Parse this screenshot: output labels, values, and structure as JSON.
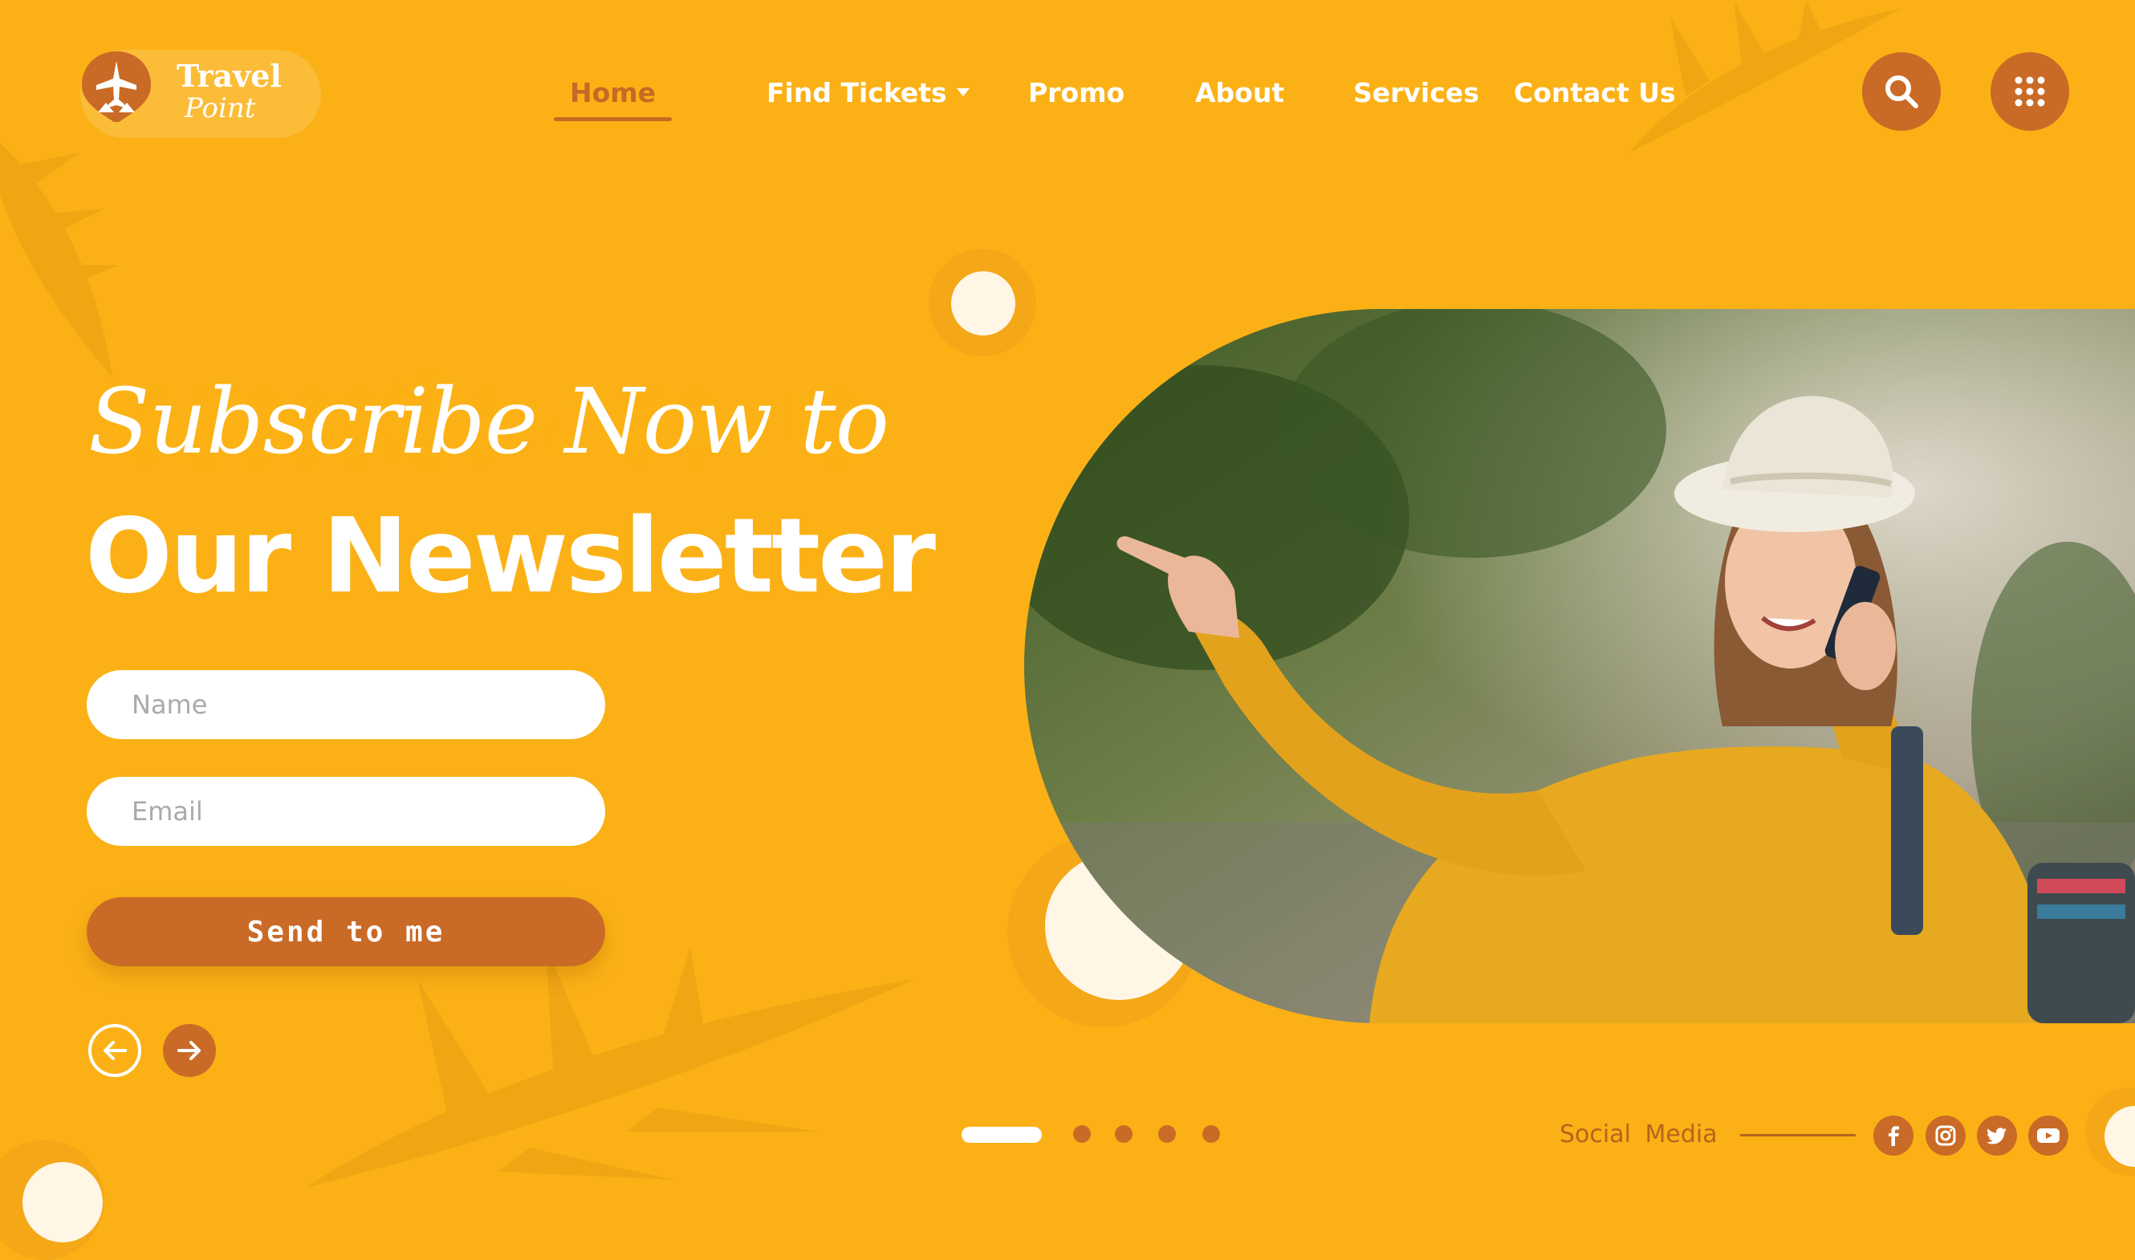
{
  "theme": {
    "background": "#fbb116",
    "accent": "#c96a26",
    "text": "#ffffff"
  },
  "logo": {
    "title": "Travel",
    "subtitle": "Point",
    "icon": "airplane-pin-icon"
  },
  "nav": {
    "items": [
      {
        "label": "Home",
        "active": true
      },
      {
        "label": "Find Tickets",
        "has_dropdown": true
      },
      {
        "label": "Promo"
      },
      {
        "label": "About"
      },
      {
        "label": "Services"
      },
      {
        "label": "Contact Us"
      }
    ],
    "search_icon": "search-icon",
    "menu_icon": "grid-menu-icon"
  },
  "hero": {
    "script_title": "Subscribe Now to",
    "title": "Our Newsletter"
  },
  "form": {
    "name_placeholder": "Name",
    "email_placeholder": "Email",
    "submit_label": "Send to me"
  },
  "carousel": {
    "prev_icon": "arrow-left-icon",
    "next_icon": "arrow-right-icon",
    "slide_count": 5,
    "active_slide": 1
  },
  "social": {
    "label": "Social Media",
    "icons": [
      "facebook-icon",
      "instagram-icon",
      "twitter-icon",
      "youtube-icon"
    ]
  },
  "photo": {
    "subject": "woman in yellow sweater and white hat pointing while on phone"
  }
}
